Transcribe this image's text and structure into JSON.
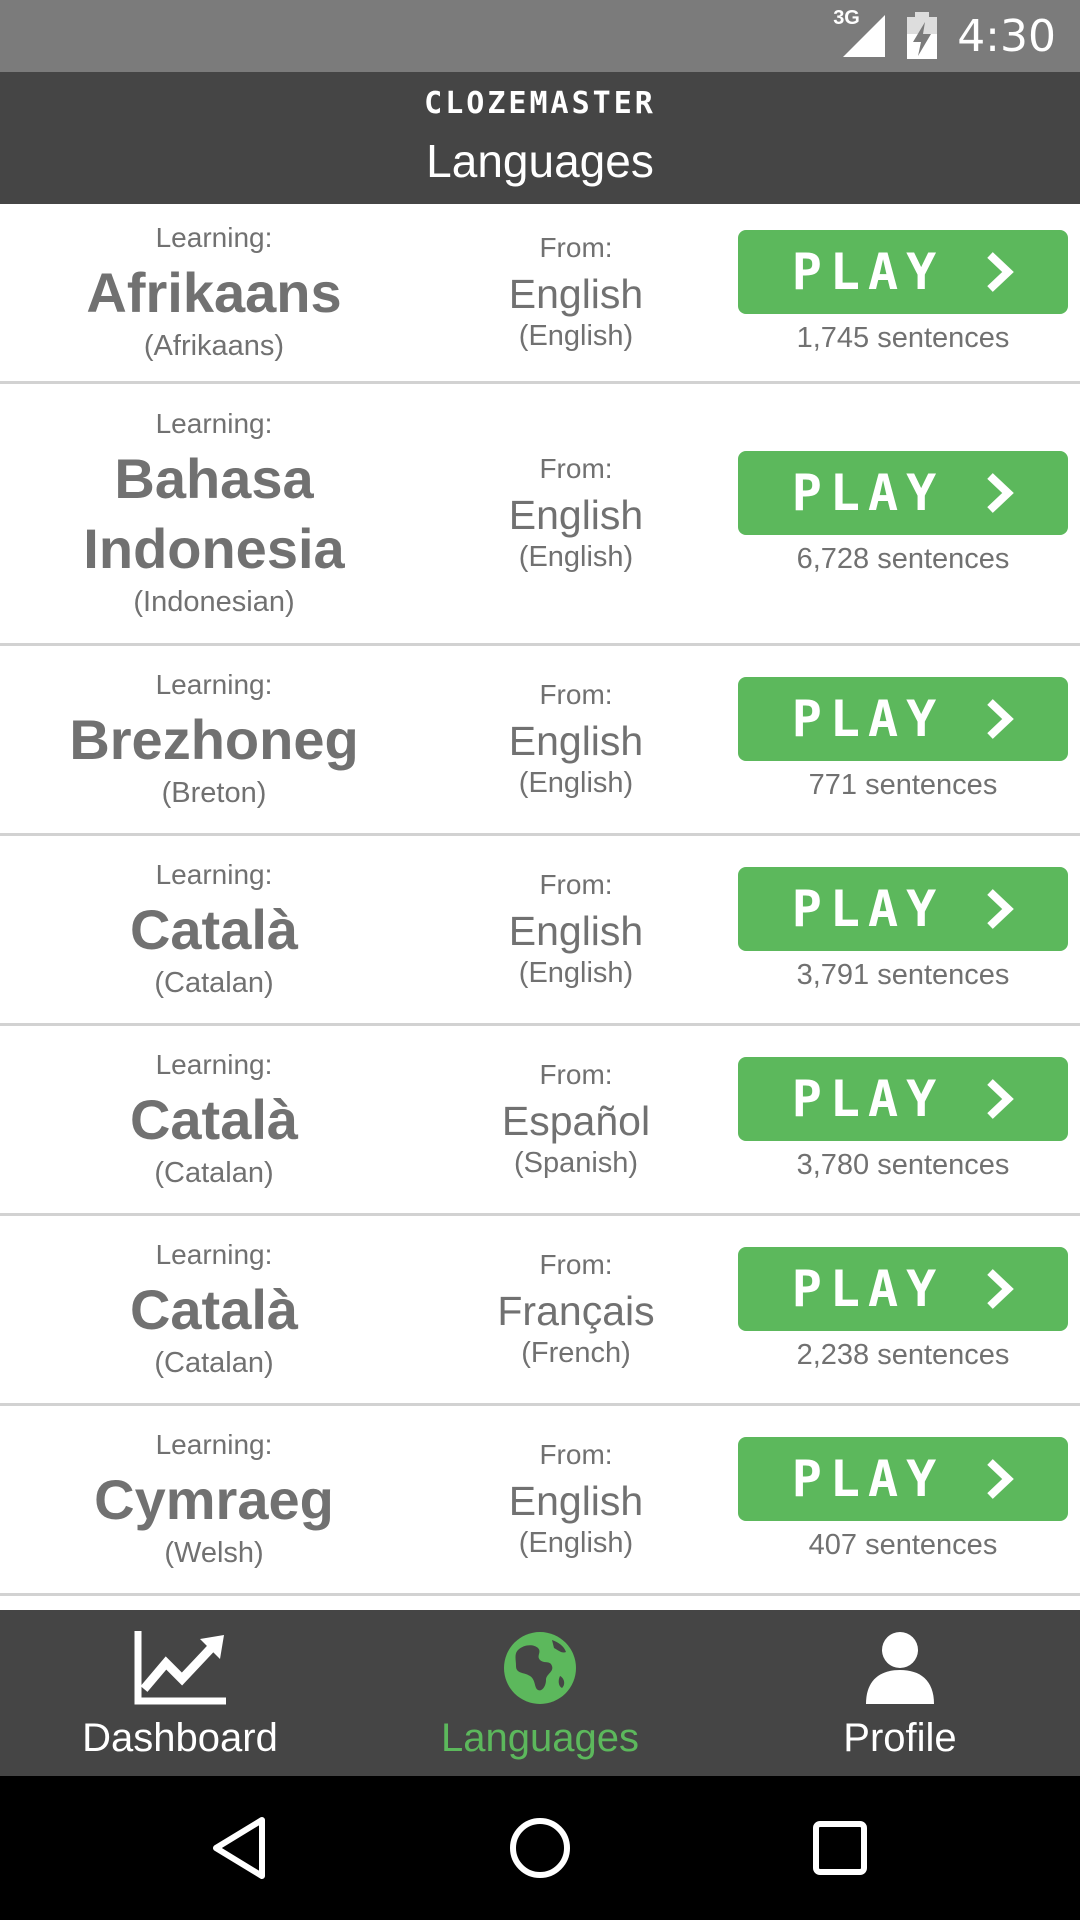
{
  "status_bar": {
    "network": "3G",
    "time": "4:30"
  },
  "header": {
    "brand": "CLOZEMASTER",
    "title": "Languages"
  },
  "languages": [
    {
      "learning_label": "Learning:",
      "name": "Afrikaans",
      "name_en": "(Afrikaans)",
      "from_label": "From:",
      "from": "English",
      "from_en": "(English)",
      "play_label": "PLAY",
      "sentences": "1,745 sentences"
    },
    {
      "learning_label": "Learning:",
      "name": "Bahasa Indonesia",
      "name_en": "(Indonesian)",
      "from_label": "From:",
      "from": "English",
      "from_en": "(English)",
      "play_label": "PLAY",
      "sentences": "6,728 sentences"
    },
    {
      "learning_label": "Learning:",
      "name": "Brezhoneg",
      "name_en": "(Breton)",
      "from_label": "From:",
      "from": "English",
      "from_en": "(English)",
      "play_label": "PLAY",
      "sentences": "771 sentences"
    },
    {
      "learning_label": "Learning:",
      "name": "Català",
      "name_en": "(Catalan)",
      "from_label": "From:",
      "from": "English",
      "from_en": "(English)",
      "play_label": "PLAY",
      "sentences": "3,791 sentences"
    },
    {
      "learning_label": "Learning:",
      "name": "Català",
      "name_en": "(Catalan)",
      "from_label": "From:",
      "from": "Español",
      "from_en": "(Spanish)",
      "play_label": "PLAY",
      "sentences": "3,780 sentences"
    },
    {
      "learning_label": "Learning:",
      "name": "Català",
      "name_en": "(Catalan)",
      "from_label": "From:",
      "from": "Français",
      "from_en": "(French)",
      "play_label": "PLAY",
      "sentences": "2,238 sentences"
    },
    {
      "learning_label": "Learning:",
      "name": "Cymraeg",
      "name_en": "(Welsh)",
      "from_label": "From:",
      "from": "English",
      "from_en": "(English)",
      "play_label": "PLAY",
      "sentences": "407 sentences"
    }
  ],
  "bottom_nav": {
    "active": "languages",
    "items": [
      {
        "label": "Dashboard",
        "icon": "chart-icon"
      },
      {
        "label": "Languages",
        "icon": "globe-icon"
      },
      {
        "label": "Profile",
        "icon": "user-icon"
      }
    ]
  },
  "colors": {
    "accent": "#5cb85c",
    "header_bg": "#454545",
    "status_bg": "#7b7b7b",
    "text_muted": "#717171"
  }
}
